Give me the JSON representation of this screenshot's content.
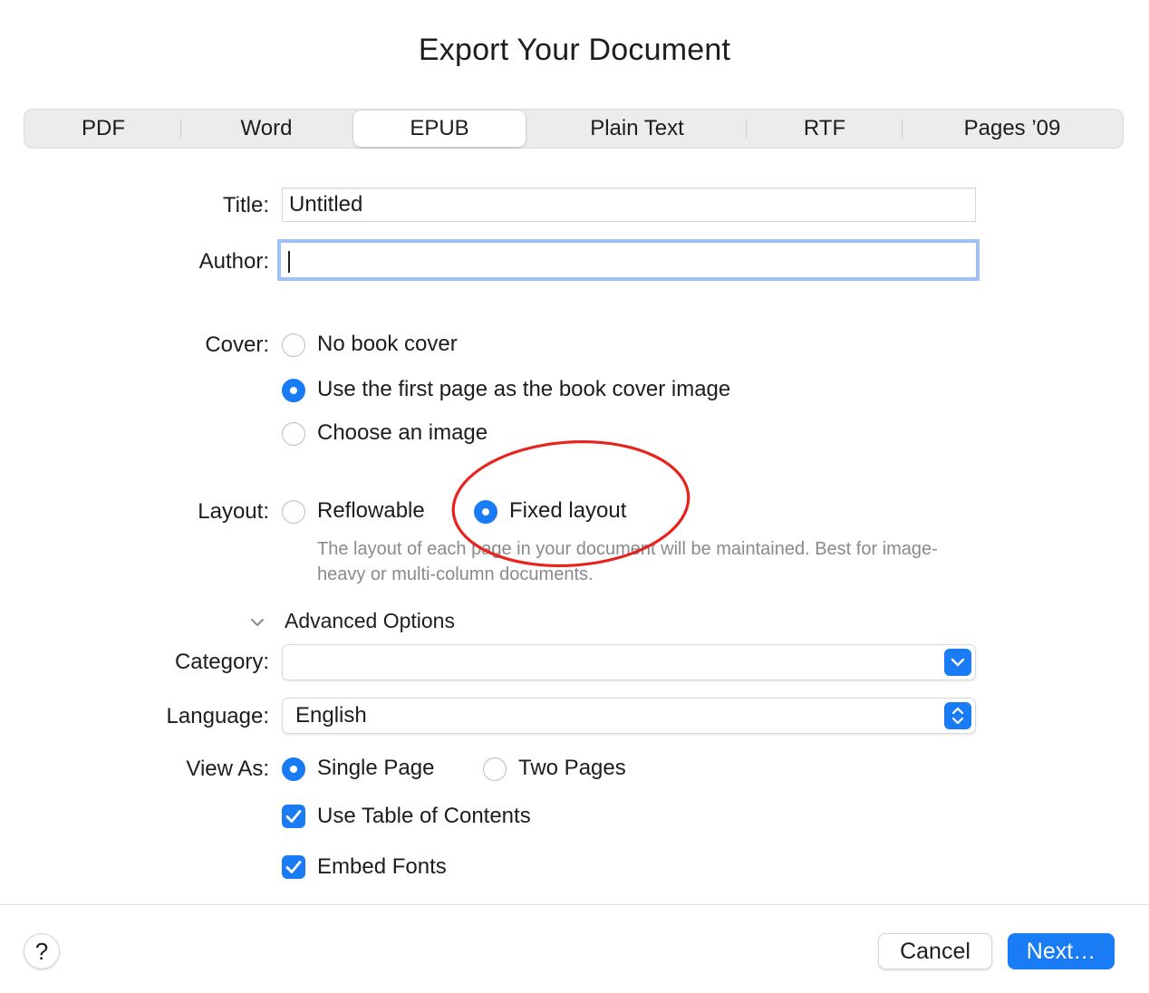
{
  "dialog": {
    "title": "Export Your Document"
  },
  "tabs": [
    {
      "label": "PDF",
      "selected": false
    },
    {
      "label": "Word",
      "selected": false
    },
    {
      "label": "EPUB",
      "selected": true
    },
    {
      "label": "Plain Text",
      "selected": false
    },
    {
      "label": "RTF",
      "selected": false
    },
    {
      "label": "Pages ’09",
      "selected": false
    }
  ],
  "form": {
    "title_label": "Title:",
    "title_value": "Untitled",
    "author_label": "Author:",
    "author_value": "",
    "cover_label": "Cover:",
    "cover_options": [
      {
        "label": "No book cover",
        "selected": false
      },
      {
        "label": "Use the first page as the book cover image",
        "selected": true
      },
      {
        "label": "Choose an image",
        "selected": false
      }
    ],
    "layout_label": "Layout:",
    "layout_options": [
      {
        "label": "Reflowable",
        "selected": false
      },
      {
        "label": "Fixed layout",
        "selected": true
      }
    ],
    "layout_help": "The layout of each page in your document will be maintained. Best for image-heavy or multi-column documents.",
    "advanced_label": "Advanced Options",
    "category_label": "Category:",
    "category_value": "",
    "language_label": "Language:",
    "language_value": "English",
    "view_as_label": "View As:",
    "view_as_options": [
      {
        "label": "Single Page",
        "selected": true
      },
      {
        "label": "Two Pages",
        "selected": false
      }
    ],
    "toc_label": "Use Table of Contents",
    "toc_checked": true,
    "embed_fonts_label": "Embed Fonts",
    "embed_fonts_checked": true
  },
  "footer": {
    "help_label": "?",
    "cancel_label": "Cancel",
    "next_label": "Next…"
  },
  "colors": {
    "accent": "#1a7cf5",
    "annotation": "#e8231d",
    "help_text": "#8a8a8e"
  }
}
